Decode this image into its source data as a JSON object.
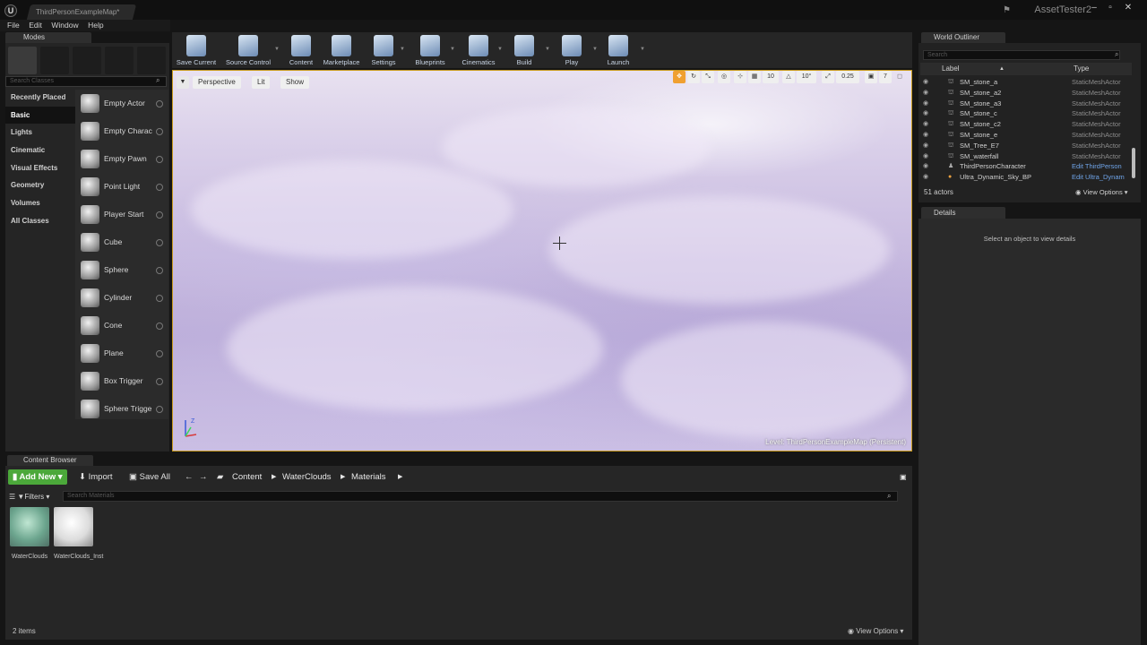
{
  "titlebar": {
    "tab_title": "ThirdPersonExampleMap*",
    "project_name": "AssetTester2",
    "minimize": "–",
    "maximize": "▫",
    "close": "✕"
  },
  "menu": [
    "File",
    "Edit",
    "Window",
    "Help"
  ],
  "modes": {
    "tab_label": "Modes",
    "search_placeholder": "Search Classes",
    "categories": [
      "Recently Placed",
      "Basic",
      "Lights",
      "Cinematic",
      "Visual Effects",
      "Geometry",
      "Volumes",
      "All Classes"
    ],
    "active_category": "Basic",
    "items": [
      "Empty Actor",
      "Empty Charac",
      "Empty Pawn",
      "Point Light",
      "Player Start",
      "Cube",
      "Sphere",
      "Cylinder",
      "Cone",
      "Plane",
      "Box Trigger",
      "Sphere Trigge"
    ]
  },
  "toolbar": {
    "buttons": [
      "Save Current",
      "Source Control",
      "Content",
      "Marketplace",
      "Settings",
      "Blueprints",
      "Cinematics",
      "Build",
      "Play",
      "Launch"
    ]
  },
  "viewport": {
    "perspective_label": "Perspective",
    "lit_label": "Lit",
    "show_label": "Show",
    "grid_snap": "10",
    "rotation_snap": "10°",
    "scale_snap": "0.25",
    "camera_speed": "7",
    "level_prefix": "Level:",
    "level_name": "ThirdPersonExampleMap (Persistent)"
  },
  "world_outliner": {
    "tab_label": "World Outliner",
    "search_placeholder": "Search",
    "col_label": "Label",
    "col_type": "Type",
    "rows": [
      {
        "label": "SM_stone_a",
        "type": "StaticMeshActor"
      },
      {
        "label": "SM_stone_a2",
        "type": "StaticMeshActor"
      },
      {
        "label": "SM_stone_a3",
        "type": "StaticMeshActor"
      },
      {
        "label": "SM_stone_c",
        "type": "StaticMeshActor"
      },
      {
        "label": "SM_stone_c2",
        "type": "StaticMeshActor"
      },
      {
        "label": "SM_stone_e",
        "type": "StaticMeshActor"
      },
      {
        "label": "SM_Tree_E7",
        "type": "StaticMeshActor"
      },
      {
        "label": "SM_waterfall",
        "type": "StaticMeshActor"
      },
      {
        "label": "ThirdPersonCharacter",
        "type": "Edit ThirdPerson"
      },
      {
        "label": "Ultra_Dynamic_Sky_BP",
        "type": "Edit Ultra_Dynam"
      }
    ],
    "actor_count": "51 actors",
    "view_options": "View Options"
  },
  "details": {
    "tab_label": "Details",
    "empty_message": "Select an object to view details"
  },
  "content_browser": {
    "tab_label": "Content Browser",
    "add_new": "Add New",
    "import": "Import",
    "save_all": "Save All",
    "breadcrumbs": [
      "Content",
      "WaterClouds",
      "Materials"
    ],
    "filters": "Filters",
    "search_placeholder": "Search Materials",
    "assets": [
      {
        "name": "WaterClouds"
      },
      {
        "name": "WaterClouds_Inst"
      }
    ],
    "item_count": "2 items",
    "view_options": "View Options"
  },
  "colors": {
    "add_new": "#4ba83a",
    "viewport_border": "#c89a1c",
    "link_blue": "#6fa4e8"
  }
}
